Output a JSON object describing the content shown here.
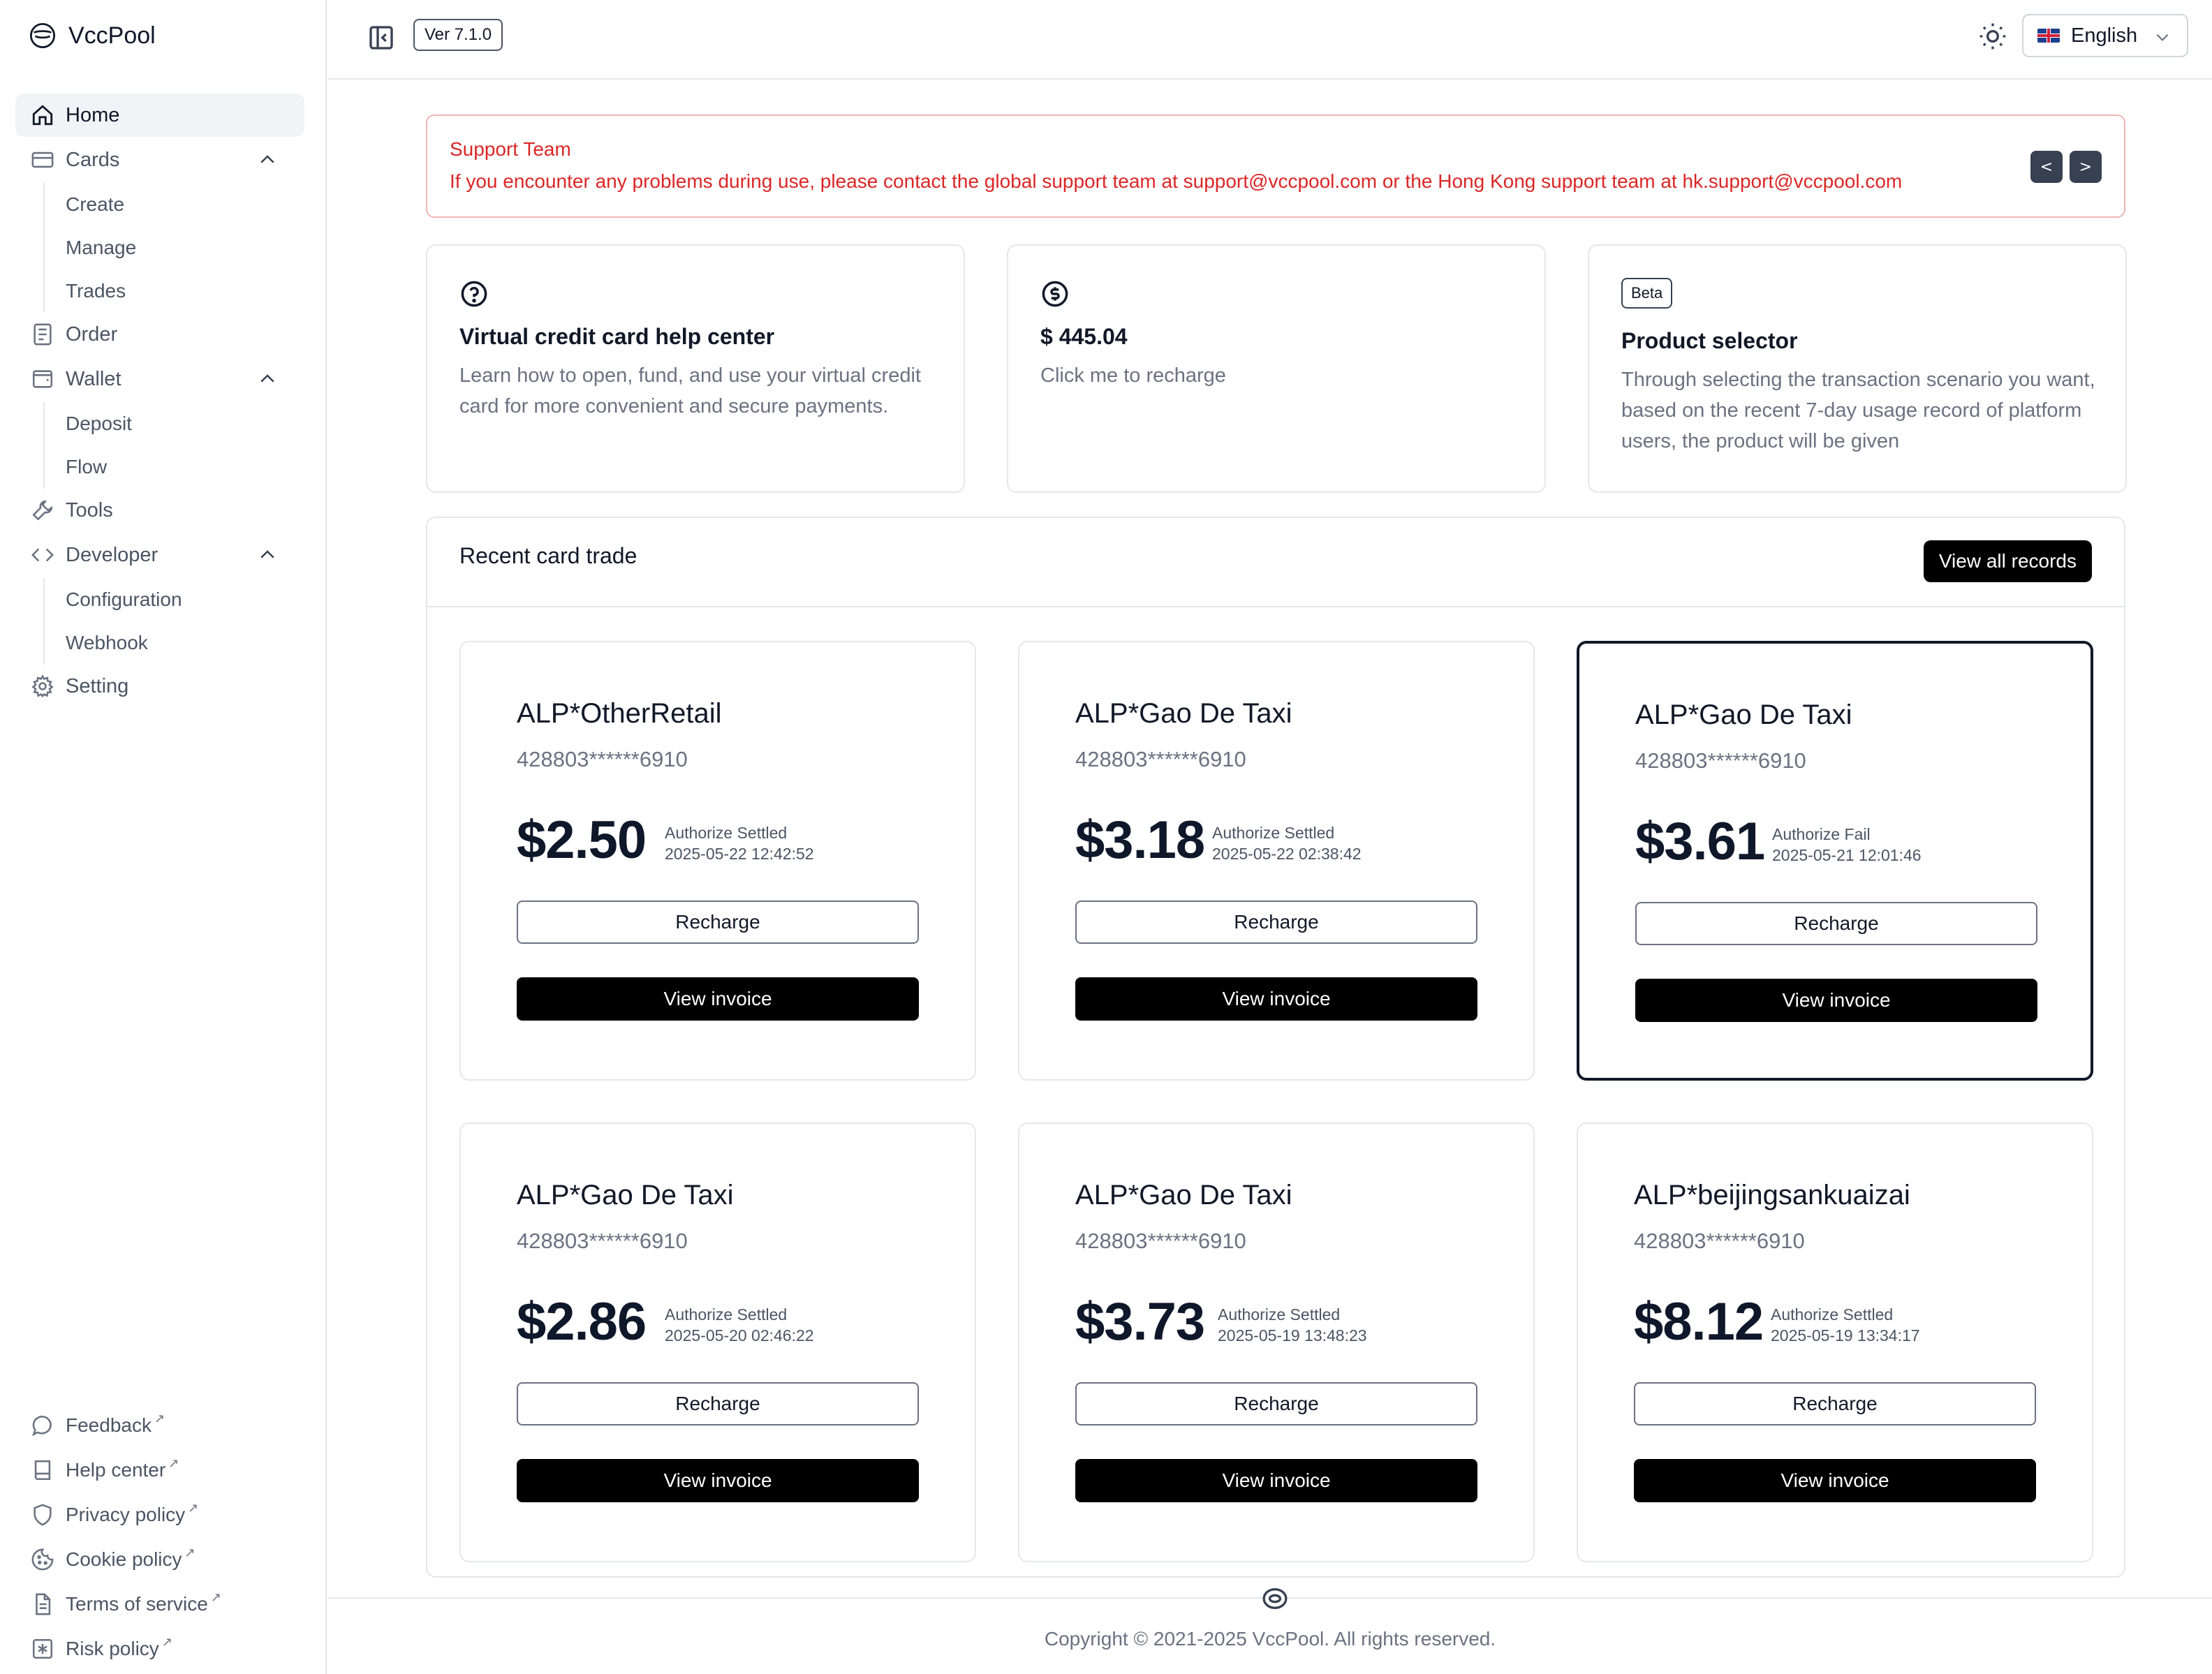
{
  "brand": {
    "name": "VccPool"
  },
  "sidebar": {
    "items": [
      {
        "label": "Home",
        "icon": "home-icon",
        "active": true
      },
      {
        "label": "Cards",
        "icon": "credit-card-icon",
        "expanded": true,
        "children": [
          {
            "label": "Create"
          },
          {
            "label": "Manage"
          },
          {
            "label": "Trades"
          }
        ]
      },
      {
        "label": "Order",
        "icon": "document-list-icon"
      },
      {
        "label": "Wallet",
        "icon": "wallet-icon",
        "expanded": true,
        "children": [
          {
            "label": "Deposit"
          },
          {
            "label": "Flow"
          }
        ]
      },
      {
        "label": "Tools",
        "icon": "wrench-icon"
      },
      {
        "label": "Developer",
        "icon": "code-icon",
        "expanded": true,
        "children": [
          {
            "label": "Configuration"
          },
          {
            "label": "Webhook"
          }
        ]
      },
      {
        "label": "Setting",
        "icon": "gear-icon"
      }
    ],
    "footer": [
      {
        "label": "Feedback",
        "icon": "chat-bubble-icon"
      },
      {
        "label": "Help center",
        "icon": "book-icon"
      },
      {
        "label": "Privacy policy",
        "icon": "shield-icon"
      },
      {
        "label": "Cookie policy",
        "icon": "cookie-icon"
      },
      {
        "label": "Terms of service",
        "icon": "document-icon"
      },
      {
        "label": "Risk policy",
        "icon": "asterisk-icon"
      }
    ]
  },
  "topbar": {
    "version": "Ver 7.1.0",
    "language": "English"
  },
  "notice": {
    "title": "Support Team",
    "text": "If you encounter any problems during use, please contact the global support team at support@vccpool.com or the Hong Kong support team at hk.support@vccpool.com",
    "prev_label": "<",
    "next_label": ">"
  },
  "tiles": {
    "help": {
      "title": "Virtual credit card help center",
      "desc": "Learn how to open, fund, and use your virtual credit card for more convenient and secure payments."
    },
    "balance": {
      "title": "$ 445.04",
      "desc": "Click me to recharge"
    },
    "selector": {
      "badge": "Beta",
      "title": "Product selector",
      "desc": "Through selecting the transaction scenario you want, based on the recent 7-day usage record of platform users, the product will be given"
    }
  },
  "trades": {
    "title": "Recent card trade",
    "view_all": "View all records",
    "recharge_label": "Recharge",
    "invoice_label": "View invoice",
    "items": [
      {
        "merchant": "ALP*OtherRetail",
        "card": "428803******6910",
        "amount": "$2.50",
        "status": "Authorize Settled",
        "time": "2025-05-22 12:42:52",
        "selected": false
      },
      {
        "merchant": "ALP*Gao De Taxi",
        "card": "428803******6910",
        "amount": "$3.18",
        "status": "Authorize Settled",
        "time": "2025-05-22 02:38:42",
        "selected": false
      },
      {
        "merchant": "ALP*Gao De Taxi",
        "card": "428803******6910",
        "amount": "$3.61",
        "status": "Authorize Fail",
        "time": "2025-05-21 12:01:46",
        "selected": true
      },
      {
        "merchant": "ALP*Gao De Taxi",
        "card": "428803******6910",
        "amount": "$2.86",
        "status": "Authorize Settled",
        "time": "2025-05-20 02:46:22",
        "selected": false
      },
      {
        "merchant": "ALP*Gao De Taxi",
        "card": "428803******6910",
        "amount": "$3.73",
        "status": "Authorize Settled",
        "time": "2025-05-19 13:48:23",
        "selected": false
      },
      {
        "merchant": "ALP*beijingsankuaizai",
        "card": "428803******6910",
        "amount": "$8.12",
        "status": "Authorize Settled",
        "time": "2025-05-19 13:34:17",
        "selected": false
      }
    ]
  },
  "footer": {
    "copyright": "Copyright © 2021-2025 VccPool. All rights reserved."
  },
  "colors": {
    "accent": "#000000",
    "notice": "#dc2626",
    "muted": "#6b7280",
    "border": "#e5e7eb"
  }
}
